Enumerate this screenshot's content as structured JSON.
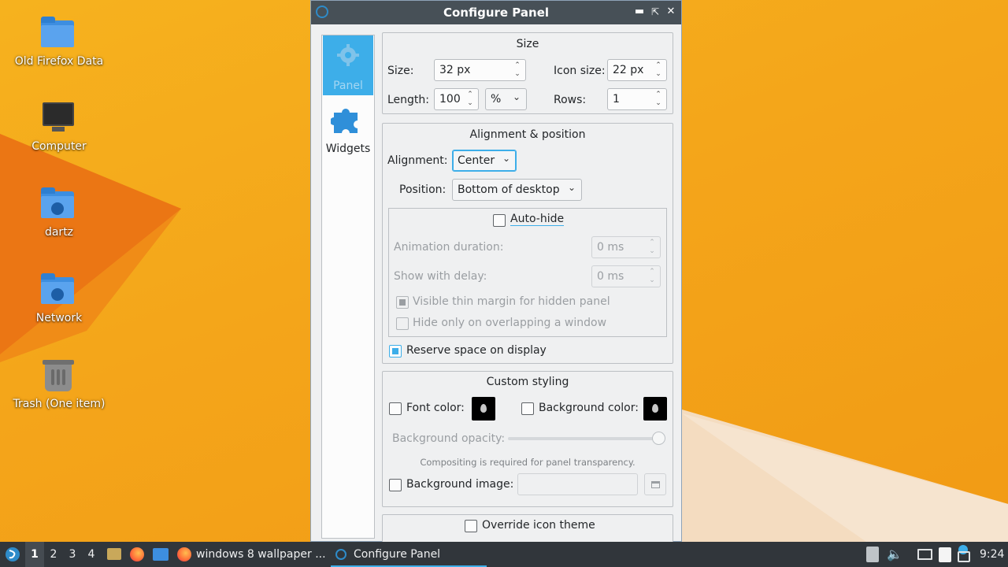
{
  "desktop": {
    "icons": [
      {
        "label": "Old Firefox Data",
        "icon": "folder-icon"
      },
      {
        "label": "Computer",
        "icon": "computer-icon"
      },
      {
        "label": "dartz",
        "icon": "home-folder-icon"
      },
      {
        "label": "Network",
        "icon": "network-folder-icon"
      },
      {
        "label": "Trash (One item)",
        "icon": "trash-icon"
      }
    ]
  },
  "window": {
    "title": "Configure Panel",
    "controls": [
      "minimize",
      "maximize",
      "close"
    ],
    "sidebar": [
      {
        "label": "Panel",
        "icon": "gear-icon",
        "active": true
      },
      {
        "label": "Widgets",
        "icon": "puzzle-icon",
        "active": false
      }
    ],
    "size_group": {
      "title": "Size",
      "size_label": "Size:",
      "size_value": "32 px",
      "icon_size_label": "Icon size:",
      "icon_size_value": "22 px",
      "length_label": "Length:",
      "length_value": "100",
      "length_unit": "%",
      "rows_label": "Rows:",
      "rows_value": "1"
    },
    "alignment_group": {
      "title": "Alignment & position",
      "alignment_label": "Alignment:",
      "alignment_value": "Center",
      "position_label": "Position:",
      "position_value": "Bottom of desktop",
      "autohide_label": "Auto-hide",
      "autohide_checked": false,
      "animation_label": "Animation duration:",
      "animation_value": "0 ms",
      "delay_label": "Show with delay:",
      "delay_value": "0 ms",
      "thin_margin_label": "Visible thin margin for hidden panel",
      "thin_margin_checked": true,
      "overlap_label": "Hide only on overlapping a window",
      "overlap_checked": false,
      "reserve_label": "Reserve space on display",
      "reserve_checked": true
    },
    "styling_group": {
      "title": "Custom styling",
      "font_color_label": "Font color:",
      "bg_color_label": "Background color:",
      "opacity_label": "Background opacity:",
      "opacity_level": 1.0,
      "compositing_note": "Compositing is required for panel transparency.",
      "bg_image_label": "Background image:",
      "bg_image_value": ""
    },
    "icon_theme_group": {
      "override_label": "Override icon theme"
    }
  },
  "taskbar": {
    "desktops": [
      "1",
      "2",
      "3",
      "4"
    ],
    "active_desktop": "1",
    "tasks": [
      {
        "label": "windows 8 wallpaper ...",
        "icon": "firefox-icon"
      },
      {
        "label": "Configure Panel",
        "icon": "lxqt-icon",
        "active": true
      }
    ],
    "clock": "9:24"
  },
  "colors": {
    "accent": "#3daee9",
    "titlebar": "#475057",
    "taskbar": "#31363b",
    "wallpaper": "#f4a51a"
  }
}
